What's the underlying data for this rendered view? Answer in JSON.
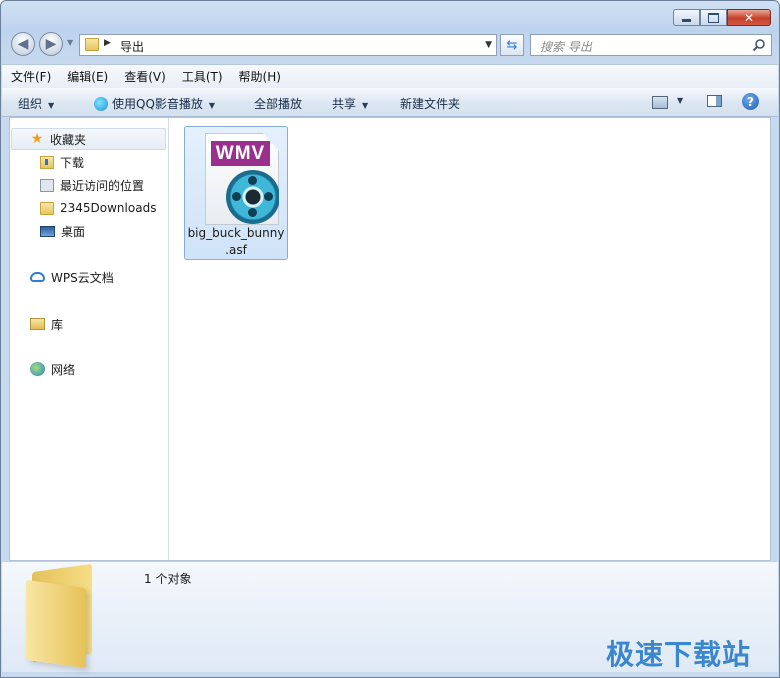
{
  "window": {
    "close_glyph": "✕"
  },
  "address": {
    "path": "导出",
    "search_placeholder": "搜索 导出"
  },
  "menubar": {
    "items": [
      "文件(F)",
      "编辑(E)",
      "查看(V)",
      "工具(T)",
      "帮助(H)"
    ]
  },
  "toolbar": {
    "organize": "组织",
    "play_qq": "使用QQ影音播放",
    "play_all": "全部播放",
    "share": "共享",
    "new_folder": "新建文件夹",
    "help_glyph": "?"
  },
  "nav": {
    "favorites": "收藏夹",
    "downloads": "下载",
    "recent": "最近访问的位置",
    "downloads2345": "2345Downloads",
    "desktop": "桌面",
    "wps": "WPS云文档",
    "library": "库",
    "network": "网络"
  },
  "files": [
    {
      "tag": "WMV",
      "name": "big_buck_bunny",
      "ext": ".asf"
    }
  ],
  "status": {
    "count": "1 个对象"
  },
  "watermark": "极速下载站",
  "icons": {
    "back": "back-arrow-icon",
    "forward": "forward-arrow-icon",
    "refresh": "refresh-icon",
    "search": "search-icon",
    "favorites": "star-icon",
    "help": "help-icon"
  }
}
